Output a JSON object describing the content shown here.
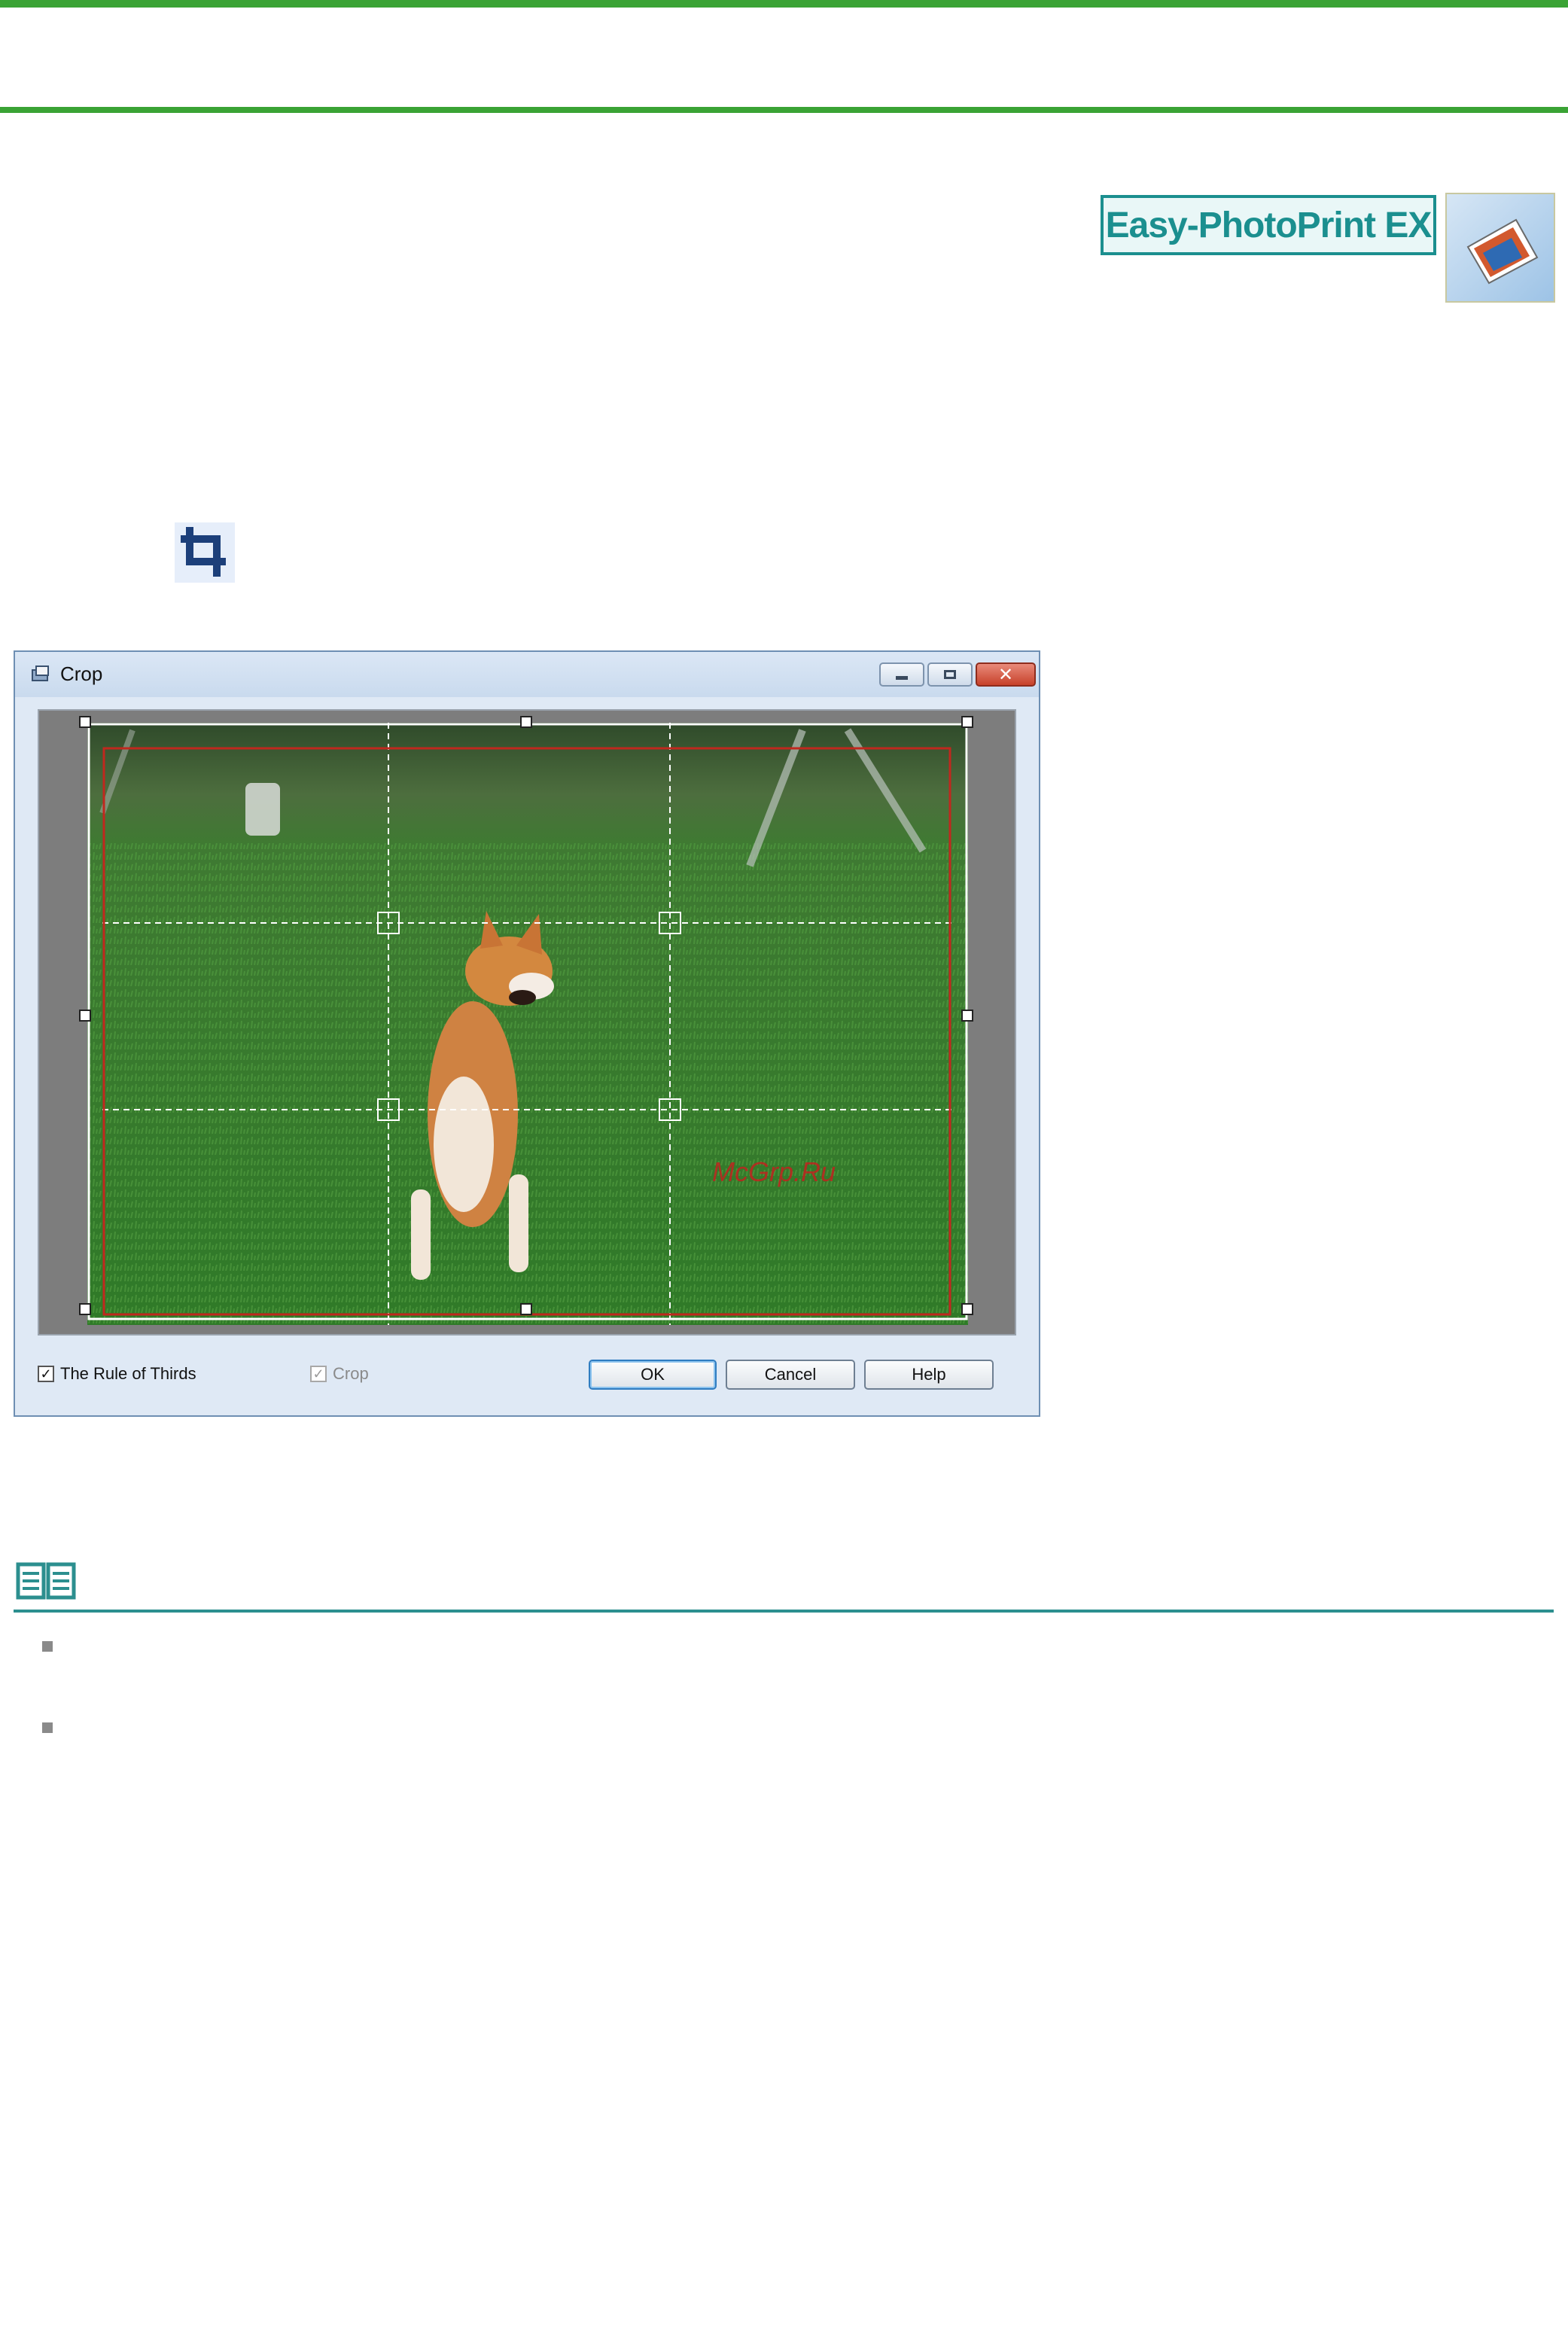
{
  "logo": {
    "text": "Easy-PhotoPrint EX",
    "icon": "photo-print-thumbnail-icon"
  },
  "crop_tool": {
    "icon": "crop-icon"
  },
  "dialog": {
    "title": "Crop",
    "title_icon": "app-icon",
    "window_buttons": [
      "minimize-icon",
      "maximize-icon",
      "close-icon"
    ],
    "checkboxes": {
      "rule_of_thirds": {
        "label": "The Rule of Thirds",
        "checked": true,
        "enabled": true
      },
      "crop": {
        "label": "Crop",
        "checked": true,
        "enabled": false
      }
    },
    "buttons": {
      "ok": "OK",
      "cancel": "Cancel",
      "help": "Help"
    },
    "watermark": "McGrp.Ru"
  },
  "note": {
    "icon": "note-book-icon",
    "bullets": 2
  },
  "colors": {
    "accent_green": "#3aa335",
    "teal": "#1b8f8f",
    "crop_frame": "#c0281e"
  }
}
